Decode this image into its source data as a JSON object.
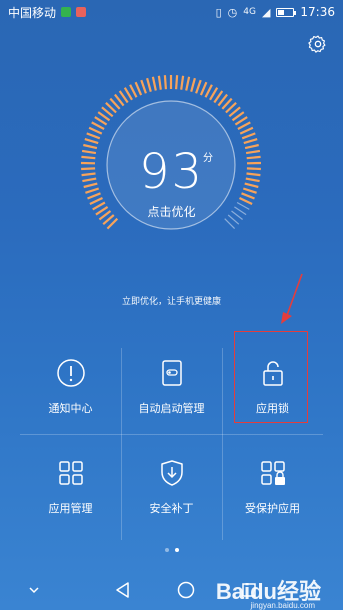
{
  "status_bar": {
    "carrier": "中国移动",
    "network": "4G",
    "time": "17:36",
    "icons": [
      "sim1-icon",
      "sim2-icon",
      "vibrate-icon",
      "alarm-icon",
      "signal-icon",
      "battery-icon"
    ]
  },
  "header": {
    "settings_icon": "gear-icon"
  },
  "gauge": {
    "score": "93",
    "unit": "分",
    "action": "点击优化",
    "score_fraction": 0.93,
    "accent_color": "#f7a35a"
  },
  "tip": "立即优化，让手机更健康",
  "grid": {
    "items": [
      {
        "label": "通知中心",
        "icon": "notification-icon"
      },
      {
        "label": "自动启动管理",
        "icon": "auto-start-icon"
      },
      {
        "label": "应用锁",
        "icon": "lock-icon"
      },
      {
        "label": "应用管理",
        "icon": "apps-grid-icon"
      },
      {
        "label": "安全补丁",
        "icon": "shield-download-icon"
      },
      {
        "label": "受保护应用",
        "icon": "protected-apps-icon"
      }
    ]
  },
  "pager": {
    "pages": 2,
    "active": 2
  },
  "navbar": {
    "buttons": [
      "chevron-down-icon",
      "back-icon",
      "home-icon",
      "recent-apps-icon"
    ]
  },
  "watermark": {
    "text": "Baidu经验",
    "sub": "jingyan.baidu.com"
  },
  "annotation_color": "#e43d3d"
}
